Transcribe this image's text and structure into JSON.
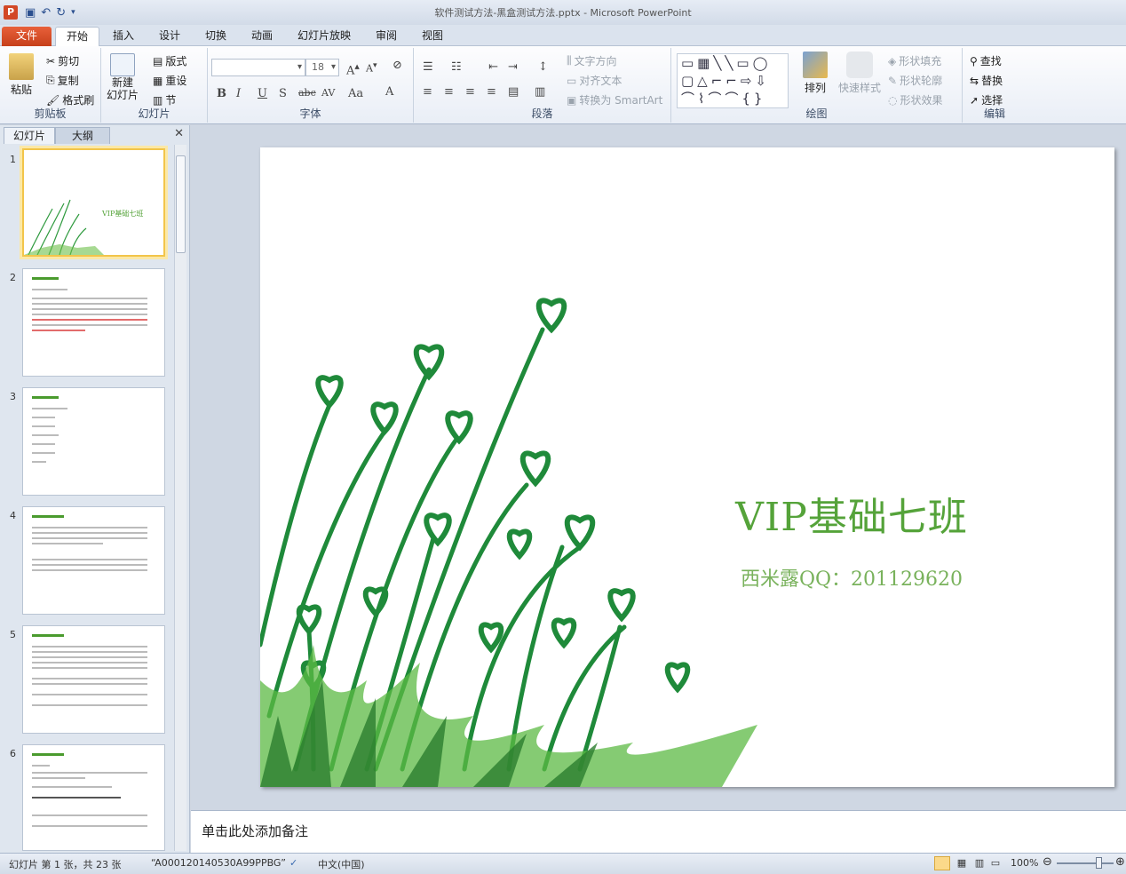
{
  "titlebar": {
    "title": "软件测试方法-黑盒测试方法.pptx - Microsoft PowerPoint",
    "app_icon": "P"
  },
  "tabs": {
    "file": "文件",
    "items": [
      "开始",
      "插入",
      "设计",
      "切换",
      "动画",
      "幻灯片放映",
      "审阅",
      "视图"
    ]
  },
  "clipboard": {
    "paste": "粘贴",
    "cut": "剪切",
    "copy": "复制",
    "format_painter": "格式刷",
    "label": "剪贴板"
  },
  "slides_group": {
    "new_slide_1": "新建",
    "new_slide_2": "幻灯片",
    "layout": "版式",
    "reset": "重设",
    "section": "节",
    "label": "幻灯片"
  },
  "font": {
    "size": "18",
    "label": "字体"
  },
  "paragraph": {
    "text_direction": "文字方向",
    "align_text": "对齐文本",
    "convert_smartart": "转换为 SmartArt",
    "label": "段落"
  },
  "drawing": {
    "arrange": "排列",
    "quick_styles": "快速样式",
    "shape_fill": "形状填充",
    "shape_outline": "形状轮廓",
    "shape_effects": "形状效果",
    "label": "绘图"
  },
  "editing": {
    "find": "查找",
    "replace": "替换",
    "select": "选择",
    "label": "编辑"
  },
  "panel": {
    "tab_slides": "幻灯片",
    "tab_outline": "大纲"
  },
  "thumbs": [
    "1",
    "2",
    "3",
    "4",
    "5",
    "6"
  ],
  "slide": {
    "title": "VIP基础七班",
    "subtitle": "西米露QQ：201129620"
  },
  "notes": {
    "placeholder": "单击此处添加备注"
  },
  "status": {
    "slide_info": "幻灯片 第 1 张，共 23 张",
    "theme": "“A000120140530A99PPBG”",
    "language": "中文(中国)",
    "zoom": "100%"
  },
  "colors": {
    "accent": "#55a33a",
    "file_tab": "#d24726"
  }
}
